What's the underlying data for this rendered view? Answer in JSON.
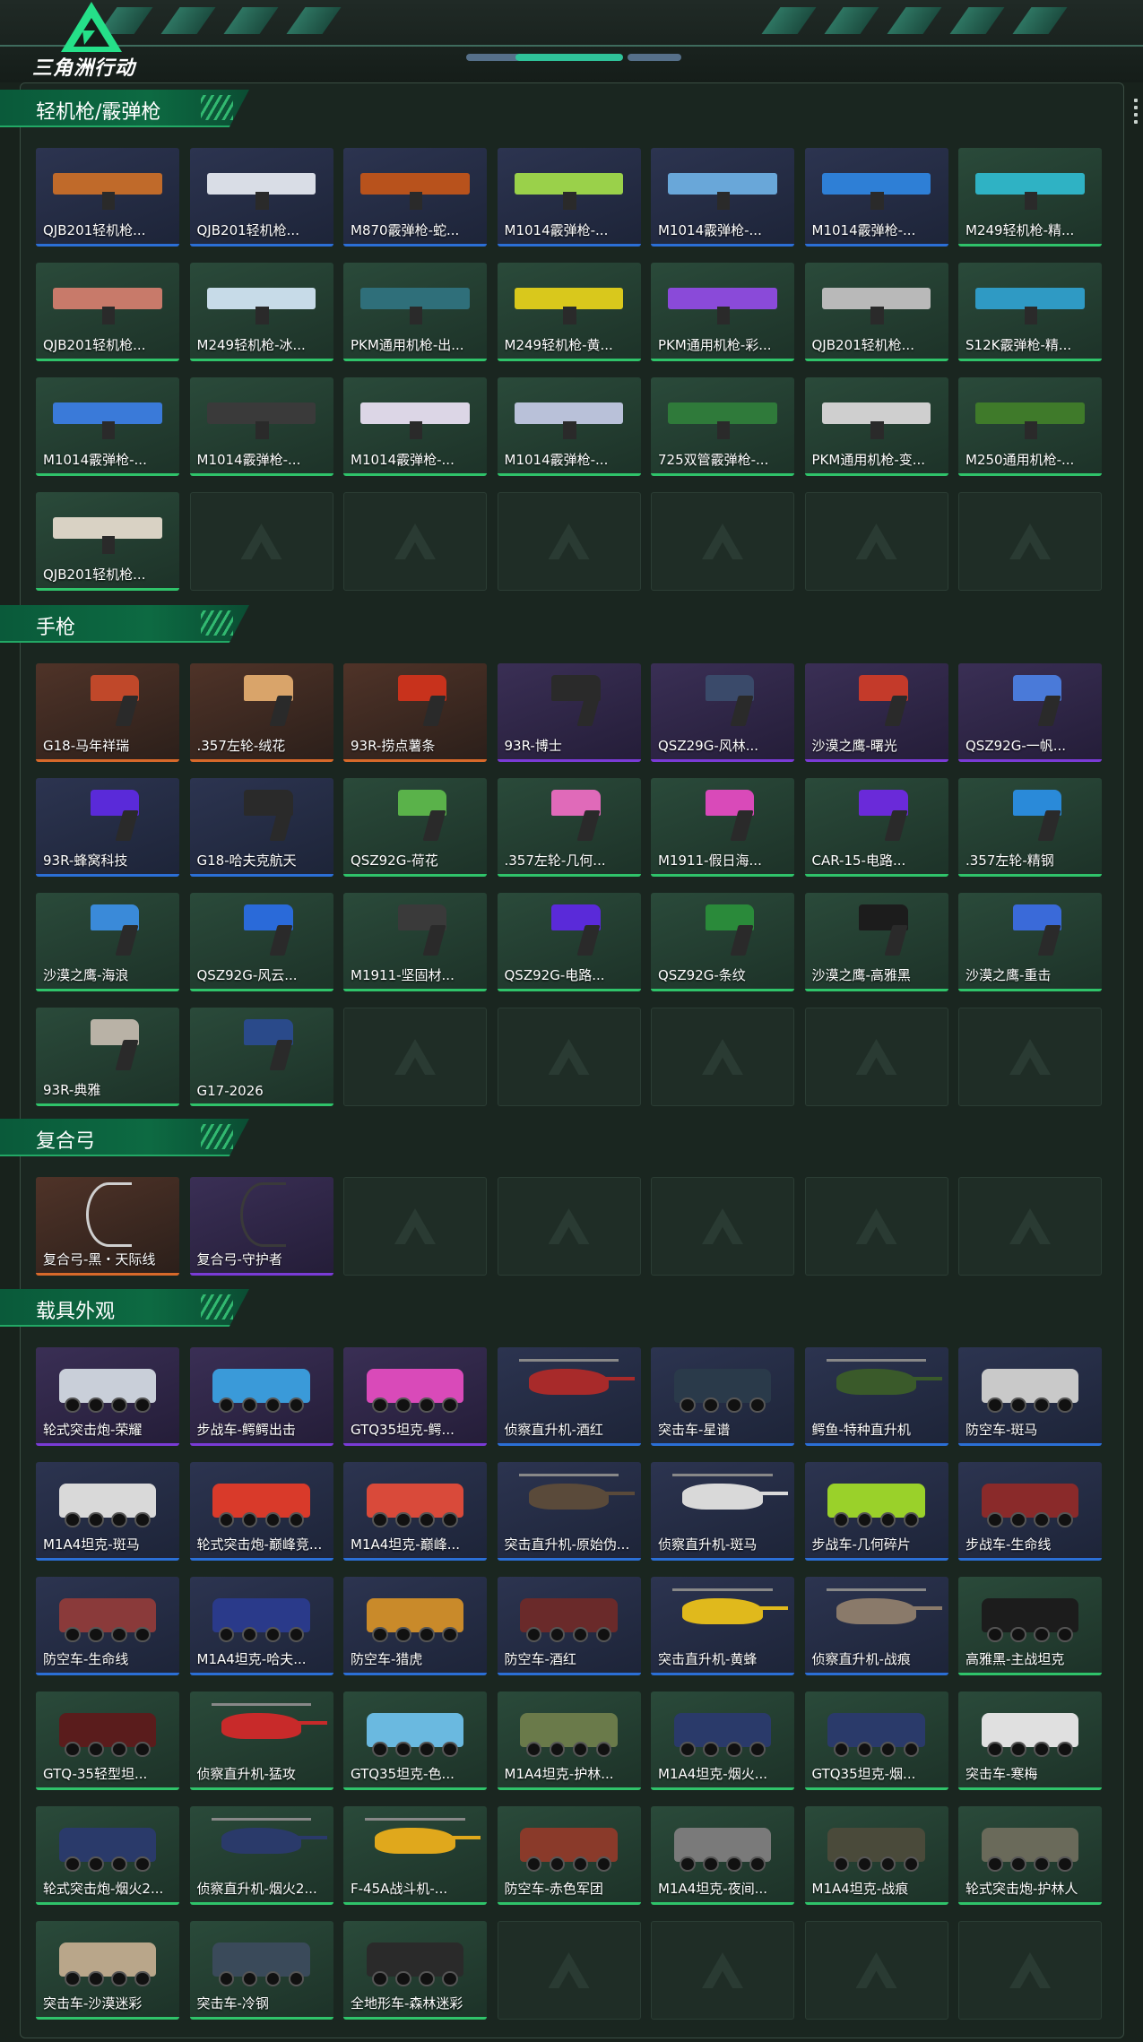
{
  "app": {
    "logo_text": "三角洲行动"
  },
  "colors": {
    "blue": "#2b6fd6",
    "purple": "#7a3bd6",
    "orange": "#d7692a",
    "green": "#2fc36a"
  },
  "sections": [
    {
      "title": "轻机枪/霰弹枪",
      "kind": "gun",
      "items": [
        {
          "name": "QJB201轻机枪...",
          "rarity": "blue",
          "tone": "#c06a2a"
        },
        {
          "name": "QJB201轻机枪...",
          "rarity": "blue",
          "tone": "#d9dde6"
        },
        {
          "name": "M870霰弹枪-蛇...",
          "rarity": "blue",
          "tone": "#b8521c"
        },
        {
          "name": "M1014霰弹枪-...",
          "rarity": "blue",
          "tone": "#9ad14a"
        },
        {
          "name": "M1014霰弹枪-...",
          "rarity": "blue",
          "tone": "#69a7d9"
        },
        {
          "name": "M1014霰弹枪-...",
          "rarity": "blue",
          "tone": "#2e7fd6"
        },
        {
          "name": "M249轻机枪-精...",
          "rarity": "green",
          "tone": "#2fb2c4"
        },
        {
          "name": "QJB201轻机枪...",
          "rarity": "green",
          "tone": "#c87a6a"
        },
        {
          "name": "M249轻机枪-冰...",
          "rarity": "green",
          "tone": "#c7dbe8"
        },
        {
          "name": "PKM通用机枪-出...",
          "rarity": "green",
          "tone": "#2f6f7a"
        },
        {
          "name": "M249轻机枪-黄...",
          "rarity": "green",
          "tone": "#d9c81c"
        },
        {
          "name": "PKM通用机枪-彩...",
          "rarity": "green",
          "tone": "#8a4ad9"
        },
        {
          "name": "QJB201轻机枪...",
          "rarity": "green",
          "tone": "#b9b9b9"
        },
        {
          "name": "S12K霰弹枪-精...",
          "rarity": "green",
          "tone": "#2f9ac4"
        },
        {
          "name": "M1014霰弹枪-...",
          "rarity": "green",
          "tone": "#3a7ad9"
        },
        {
          "name": "M1014霰弹枪-...",
          "rarity": "green",
          "tone": "#3a3a3a"
        },
        {
          "name": "M1014霰弹枪-...",
          "rarity": "green",
          "tone": "#dcd6e6"
        },
        {
          "name": "M1014霰弹枪-...",
          "rarity": "green",
          "tone": "#b9c1d9"
        },
        {
          "name": "725双管霰弹枪-...",
          "rarity": "green",
          "tone": "#2f7a3a"
        },
        {
          "name": "PKM通用机枪-变...",
          "rarity": "green",
          "tone": "#cfcfcf"
        },
        {
          "name": "M250通用机枪-...",
          "rarity": "green",
          "tone": "#3f7a2a"
        },
        {
          "name": "QJB201轻机枪...",
          "rarity": "green",
          "tone": "#d9d2c4"
        }
      ],
      "empty_slots": 6
    },
    {
      "title": "手枪",
      "kind": "pistol",
      "items": [
        {
          "name": "G18-马年祥瑞",
          "rarity": "orange",
          "tone": "#c0482a"
        },
        {
          "name": ".357左轮-绒花",
          "rarity": "orange",
          "tone": "#d9a46a"
        },
        {
          "name": "93R-捞点薯条",
          "rarity": "orange",
          "tone": "#c8321c"
        },
        {
          "name": "93R-博士",
          "rarity": "purple",
          "tone": "#2a2a2a"
        },
        {
          "name": "QSZ29G-风林...",
          "rarity": "purple",
          "tone": "#3a4a6a"
        },
        {
          "name": "沙漠之鹰-曙光",
          "rarity": "purple",
          "tone": "#c43a2a"
        },
        {
          "name": "QSZ92G-一帆...",
          "rarity": "purple",
          "tone": "#4a7ad9"
        },
        {
          "name": "93R-蜂窝科技",
          "rarity": "blue",
          "tone": "#5a2ad9"
        },
        {
          "name": "G18-哈夫克航天",
          "rarity": "blue",
          "tone": "#2a2a2a"
        },
        {
          "name": "QSZ92G-荷花",
          "rarity": "green",
          "tone": "#5ab24a"
        },
        {
          "name": ".357左轮-几何...",
          "rarity": "green",
          "tone": "#e06ab9"
        },
        {
          "name": "M1911-假日海...",
          "rarity": "green",
          "tone": "#d94ab9"
        },
        {
          "name": "CAR-15-电路...",
          "rarity": "green",
          "tone": "#6a2ad9"
        },
        {
          "name": ".357左轮-精钢",
          "rarity": "green",
          "tone": "#2a8ad9"
        },
        {
          "name": "沙漠之鹰-海浪",
          "rarity": "green",
          "tone": "#3a8ad9"
        },
        {
          "name": "QSZ92G-风云...",
          "rarity": "green",
          "tone": "#2a6ad9"
        },
        {
          "name": "M1911-坚固材...",
          "rarity": "green",
          "tone": "#3a3a3a"
        },
        {
          "name": "QSZ92G-电路...",
          "rarity": "green",
          "tone": "#5a2ad9"
        },
        {
          "name": "QSZ92G-条纹",
          "rarity": "green",
          "tone": "#2a8a3a"
        },
        {
          "name": "沙漠之鹰-高雅黑",
          "rarity": "green",
          "tone": "#1c1c1c"
        },
        {
          "name": "沙漠之鹰-重击",
          "rarity": "green",
          "tone": "#3a6ad9"
        },
        {
          "name": "93R-典雅",
          "rarity": "green",
          "tone": "#b9b2a6"
        },
        {
          "name": "G17-2026",
          "rarity": "green",
          "tone": "#2a4a8a"
        }
      ],
      "empty_slots": 5
    },
    {
      "title": "复合弓",
      "kind": "bow",
      "items": [
        {
          "name": "复合弓-黑・天际线",
          "rarity": "orange",
          "tone": "#cfcfcf"
        },
        {
          "name": "复合弓-守护者",
          "rarity": "purple",
          "tone": "#3a3a3a"
        }
      ],
      "empty_slots": 5
    },
    {
      "title": "载具外观",
      "kind": "vehicle",
      "items": [
        {
          "name": "轮式突击炮-荣耀",
          "rarity": "purple",
          "tone": "#c9cfd9",
          "shape": "vehicle"
        },
        {
          "name": "步战车-鳄鳄出击",
          "rarity": "purple",
          "tone": "#3a9ad9",
          "shape": "vehicle"
        },
        {
          "name": "GTQ35坦克-鳄...",
          "rarity": "purple",
          "tone": "#d94ab9",
          "shape": "vehicle"
        },
        {
          "name": "侦察直升机-酒红",
          "rarity": "blue",
          "tone": "#a82a2a",
          "shape": "heli"
        },
        {
          "name": "突击车-星谱",
          "rarity": "blue",
          "tone": "#2a3a4a",
          "shape": "vehicle"
        },
        {
          "name": "鳄鱼-特种直升机",
          "rarity": "blue",
          "tone": "#3a5a2a",
          "shape": "heli"
        },
        {
          "name": "防空车-斑马",
          "rarity": "blue",
          "tone": "#c9c9c9",
          "shape": "vehicle"
        },
        {
          "name": "M1A4坦克-斑马",
          "rarity": "blue",
          "tone": "#d9d9d9",
          "shape": "vehicle"
        },
        {
          "name": "轮式突击炮-巅峰竞...",
          "rarity": "blue",
          "tone": "#d93a2a",
          "shape": "vehicle"
        },
        {
          "name": "M1A4坦克-巅峰...",
          "rarity": "blue",
          "tone": "#d94a3a",
          "shape": "vehicle"
        },
        {
          "name": "突击直升机-原始伪...",
          "rarity": "blue",
          "tone": "#5a4a3a",
          "shape": "heli"
        },
        {
          "name": "侦察直升机-斑马",
          "rarity": "blue",
          "tone": "#d9d9d9",
          "shape": "heli"
        },
        {
          "name": "步战车-几何碎片",
          "rarity": "blue",
          "tone": "#9ad12a",
          "shape": "vehicle"
        },
        {
          "name": "步战车-生命线",
          "rarity": "blue",
          "tone": "#8a2a2a",
          "shape": "vehicle"
        },
        {
          "name": "防空车-生命线",
          "rarity": "blue",
          "tone": "#8a3a3a",
          "shape": "vehicle"
        },
        {
          "name": "M1A4坦克-哈夫...",
          "rarity": "blue",
          "tone": "#2a3a8a",
          "shape": "vehicle"
        },
        {
          "name": "防空车-猎虎",
          "rarity": "blue",
          "tone": "#c98a2a",
          "shape": "vehicle"
        },
        {
          "name": "防空车-酒红",
          "rarity": "blue",
          "tone": "#6a2a2a",
          "shape": "vehicle"
        },
        {
          "name": "突击直升机-黄蜂",
          "rarity": "blue",
          "tone": "#e0b91c",
          "shape": "heli"
        },
        {
          "name": "侦察直升机-战痕",
          "rarity": "blue",
          "tone": "#8a7a6a",
          "shape": "heli"
        },
        {
          "name": "高雅黑-主战坦克",
          "rarity": "green",
          "tone": "#1c1c1c",
          "shape": "vehicle"
        },
        {
          "name": "GTQ-35轻型坦...",
          "rarity": "green",
          "tone": "#5a1c1c",
          "shape": "vehicle"
        },
        {
          "name": "侦察直升机-猛攻",
          "rarity": "green",
          "tone": "#c82a2a",
          "shape": "heli"
        },
        {
          "name": "GTQ35坦克-色...",
          "rarity": "green",
          "tone": "#6ab9e0",
          "shape": "vehicle"
        },
        {
          "name": "M1A4坦克-护林...",
          "rarity": "green",
          "tone": "#6a7a4a",
          "shape": "vehicle"
        },
        {
          "name": "M1A4坦克-烟火...",
          "rarity": "green",
          "tone": "#2a3a6a",
          "shape": "vehicle"
        },
        {
          "name": "GTQ35坦克-烟...",
          "rarity": "green",
          "tone": "#2a3a6a",
          "shape": "vehicle"
        },
        {
          "name": "突击车-寒梅",
          "rarity": "green",
          "tone": "#e0e0e0",
          "shape": "vehicle"
        },
        {
          "name": "轮式突击炮-烟火2...",
          "rarity": "green",
          "tone": "#2a3a6a",
          "shape": "vehicle"
        },
        {
          "name": "侦察直升机-烟火2...",
          "rarity": "green",
          "tone": "#2a3a6a",
          "shape": "heli"
        },
        {
          "name": "F-45A战斗机-...",
          "rarity": "green",
          "tone": "#e0a81c",
          "shape": "heli"
        },
        {
          "name": "防空车-赤色军团",
          "rarity": "green",
          "tone": "#8a3a2a",
          "shape": "vehicle"
        },
        {
          "name": "M1A4坦克-夜间...",
          "rarity": "green",
          "tone": "#7a7a7a",
          "shape": "vehicle"
        },
        {
          "name": "M1A4坦克-战痕",
          "rarity": "green",
          "tone": "#4a4a3a",
          "shape": "vehicle"
        },
        {
          "name": "轮式突击炮-护林人",
          "rarity": "green",
          "tone": "#6a6a5a",
          "shape": "vehicle"
        },
        {
          "name": "突击车-沙漠迷彩",
          "rarity": "green",
          "tone": "#b9a68a",
          "shape": "vehicle"
        },
        {
          "name": "突击车-冷钢",
          "rarity": "green",
          "tone": "#3a4a5a",
          "shape": "vehicle"
        },
        {
          "name": "全地形车-森林迷彩",
          "rarity": "green",
          "tone": "#2a2a2a",
          "shape": "vehicle"
        }
      ],
      "empty_slots": 4
    }
  ]
}
